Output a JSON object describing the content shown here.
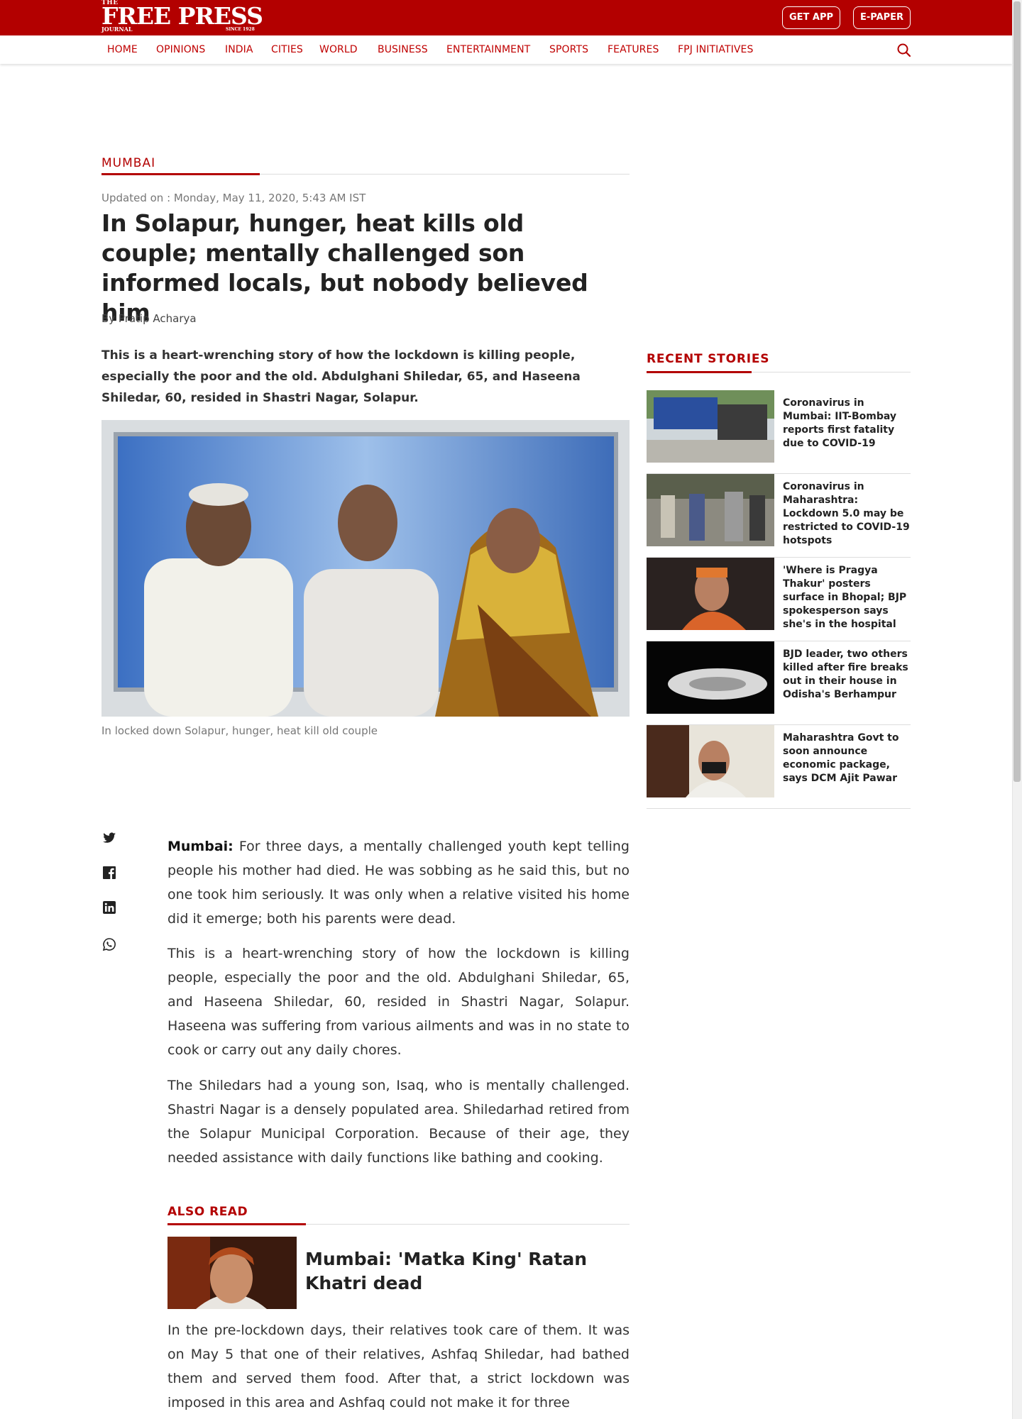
{
  "header": {
    "logo": {
      "the": "THE",
      "name": "FREE PRESS",
      "journal": "JOURNAL",
      "since": "SINCE 1928"
    },
    "get_app": "GET APP",
    "epaper": "E-PAPER"
  },
  "nav": {
    "items": [
      "HOME",
      "OPINIONS",
      "INDIA",
      "CITIES",
      "WORLD",
      "BUSINESS",
      "ENTERTAINMENT",
      "SPORTS",
      "FEATURES",
      "FPJ INITIATIVES"
    ]
  },
  "article": {
    "section": "MUMBAI",
    "updated": "Updated on : Monday, May 11, 2020, 5:43 AM IST",
    "headline": "In Solapur, hunger, heat kills old couple; mentally challenged son informed locals, but nobody believed him",
    "byline": "By Pratip Acharya",
    "summary": "This is a heart-wrenching story of how the lockdown is killing people, especially the poor and the old. Abdulghani Shiledar, 65, and Haseena Shiledar, 60, resided in Shastri Nagar, Solapur.",
    "caption": "In locked down Solapur, hunger, heat kill old couple",
    "p1_lead": "Mumbai:",
    "p1_rest": " For three days, a mentally challenged youth kept telling people his mother had died. He was sobbing as he said this, but no one took him seriously. It was only when a relative visited his home did it emerge; both his parents were dead.",
    "p2": "This is a heart-wrenching story of how the lockdown is killing people, especially the poor and the old. Abdulghani Shiledar, 65, and Haseena Shiledar, 60, resided in Shastri Nagar, Solapur. Haseena was suffering from various ailments and was in no state to cook or carry out any daily chores.",
    "p3": "The Shiledars had a young son, Isaq, who is mentally challenged. Shastri Nagar is a densely populated area. Shiledarhad retired from the Solapur Municipal Corporation. Because of their age, they needed assistance with daily functions like bathing and cooking.",
    "p4": "In the pre-lockdown days, their relatives took care of them. It was on May 5 that one of their relatives, Ashfaq Shiledar, had bathed them and served them food. After that, a strict lockdown was imposed in this area and Ashfaq could not make it for three"
  },
  "also_read": {
    "label": "ALSO READ",
    "title": "Mumbai: 'Matka King' Ratan Khatri dead"
  },
  "sidebar": {
    "label": "RECENT STORIES",
    "stories": [
      {
        "title": "Coronavirus in Mumbai: IIT-Bombay reports first fatality due to COVID-19"
      },
      {
        "title": "Coronavirus in Maharashtra: Lockdown 5.0 may be restricted to COVID-19 hotspots"
      },
      {
        "title": "'Where is Pragya Thakur' posters surface in Bhopal; BJP spokesperson says she's in the hospital"
      },
      {
        "title": "BJD leader, two others killed after fire breaks out in their house in Odisha's Berhampur"
      },
      {
        "title": "Maharashtra Govt to soon announce economic package, says DCM Ajit Pawar"
      }
    ]
  },
  "colors": {
    "brand": "#b30000",
    "text": "#222222",
    "muted": "#777777"
  }
}
